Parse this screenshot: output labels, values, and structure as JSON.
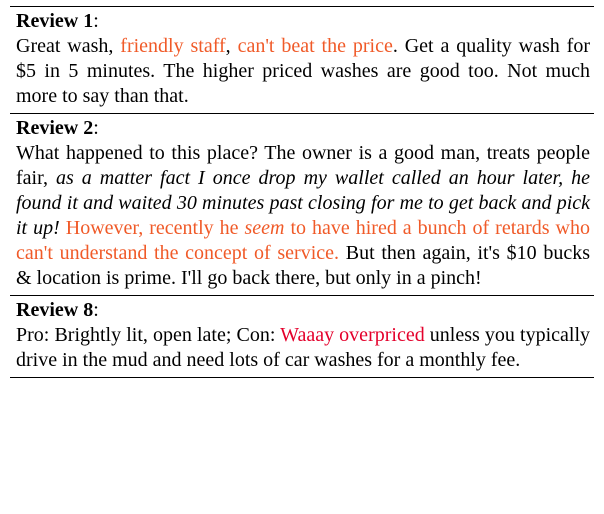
{
  "reviews": {
    "r1": {
      "heading": "Review 1",
      "colon": ":",
      "p1a": "Great wash, ",
      "p1b": "friendly staff",
      "p1c": ", ",
      "p1d": "can't beat the price",
      "p1e": ".  Get a quality wash for $5 in 5 minutes. The higher priced washes are good too. Not much more to say than that."
    },
    "r2": {
      "heading": "Review 2",
      "colon": ":",
      "p2a": "What happened to this place? The owner is a good man, treats people fair, ",
      "p2b": "as a matter fact I once drop my wallet called an hour later, he found it and waited 30 minutes past closing for me to get back and pick it up! ",
      "p2c": "However, recently he ",
      "p2d": "seem",
      "p2e": " to have hired a bunch of retards who can't understand the concept of service.",
      "p2f": " But then again, it's $10 bucks & location is prime. I'll go back there, but only in a pinch!"
    },
    "r8": {
      "heading": "Review 8",
      "colon": ":",
      "p8a": "Pro: Brightly lit, open late; Con: ",
      "p8b": "Waaay overpriced",
      "p8c": " unless you typically drive in the mud and need lots of car washes for a monthly fee."
    }
  }
}
